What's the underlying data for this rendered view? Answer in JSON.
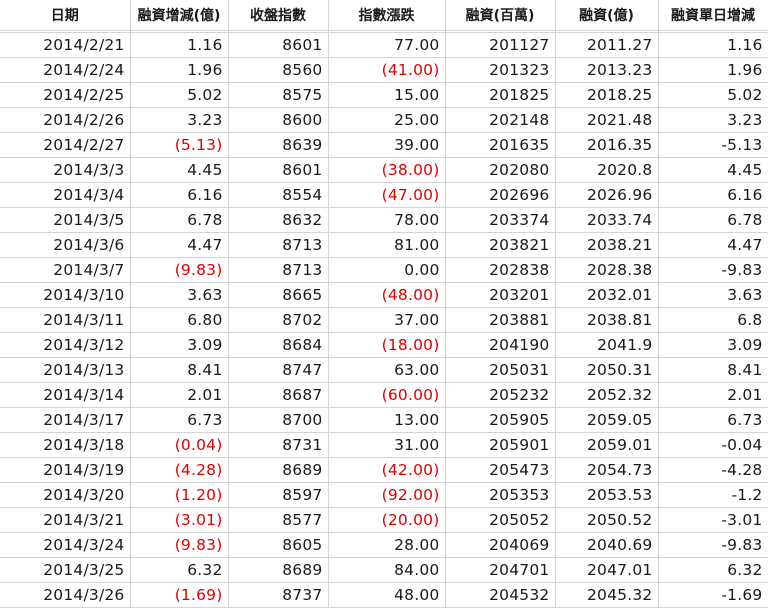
{
  "columns": [
    "日期",
    "融資增減(億)",
    "收盤指數",
    "指數漲跌",
    "融資(百萬)",
    "融資(億)",
    "融資單日增減"
  ],
  "colors": {
    "negative": "#e00000",
    "text": "#1a1a1a",
    "grid": "#d4d4d4"
  },
  "rows": [
    [
      "2014/2/21",
      "1.16",
      "8601",
      "77.00",
      "201127",
      "2011.27",
      "1.16"
    ],
    [
      "2014/2/24",
      "1.96",
      "8560",
      "(41.00)",
      "201323",
      "2013.23",
      "1.96"
    ],
    [
      "2014/2/25",
      "5.02",
      "8575",
      "15.00",
      "201825",
      "2018.25",
      "5.02"
    ],
    [
      "2014/2/26",
      "3.23",
      "8600",
      "25.00",
      "202148",
      "2021.48",
      "3.23"
    ],
    [
      "2014/2/27",
      "(5.13)",
      "8639",
      "39.00",
      "201635",
      "2016.35",
      "-5.13"
    ],
    [
      "2014/3/3",
      "4.45",
      "8601",
      "(38.00)",
      "202080",
      "2020.8",
      "4.45"
    ],
    [
      "2014/3/4",
      "6.16",
      "8554",
      "(47.00)",
      "202696",
      "2026.96",
      "6.16"
    ],
    [
      "2014/3/5",
      "6.78",
      "8632",
      "78.00",
      "203374",
      "2033.74",
      "6.78"
    ],
    [
      "2014/3/6",
      "4.47",
      "8713",
      "81.00",
      "203821",
      "2038.21",
      "4.47"
    ],
    [
      "2014/3/7",
      "(9.83)",
      "8713",
      "0.00",
      "202838",
      "2028.38",
      "-9.83"
    ],
    [
      "2014/3/10",
      "3.63",
      "8665",
      "(48.00)",
      "203201",
      "2032.01",
      "3.63"
    ],
    [
      "2014/3/11",
      "6.80",
      "8702",
      "37.00",
      "203881",
      "2038.81",
      "6.8"
    ],
    [
      "2014/3/12",
      "3.09",
      "8684",
      "(18.00)",
      "204190",
      "2041.9",
      "3.09"
    ],
    [
      "2014/3/13",
      "8.41",
      "8747",
      "63.00",
      "205031",
      "2050.31",
      "8.41"
    ],
    [
      "2014/3/14",
      "2.01",
      "8687",
      "(60.00)",
      "205232",
      "2052.32",
      "2.01"
    ],
    [
      "2014/3/17",
      "6.73",
      "8700",
      "13.00",
      "205905",
      "2059.05",
      "6.73"
    ],
    [
      "2014/3/18",
      "(0.04)",
      "8731",
      "31.00",
      "205901",
      "2059.01",
      "-0.04"
    ],
    [
      "2014/3/19",
      "(4.28)",
      "8689",
      "(42.00)",
      "205473",
      "2054.73",
      "-4.28"
    ],
    [
      "2014/3/20",
      "(1.20)",
      "8597",
      "(92.00)",
      "205353",
      "2053.53",
      "-1.2"
    ],
    [
      "2014/3/21",
      "(3.01)",
      "8577",
      "(20.00)",
      "205052",
      "2050.52",
      "-3.01"
    ],
    [
      "2014/3/24",
      "(9.83)",
      "8605",
      "28.00",
      "204069",
      "2040.69",
      "-9.83"
    ],
    [
      "2014/3/25",
      "6.32",
      "8689",
      "84.00",
      "204701",
      "2047.01",
      "6.32"
    ],
    [
      "2014/3/26",
      "(1.69)",
      "8737",
      "48.00",
      "204532",
      "2045.32",
      "-1.69"
    ]
  ]
}
